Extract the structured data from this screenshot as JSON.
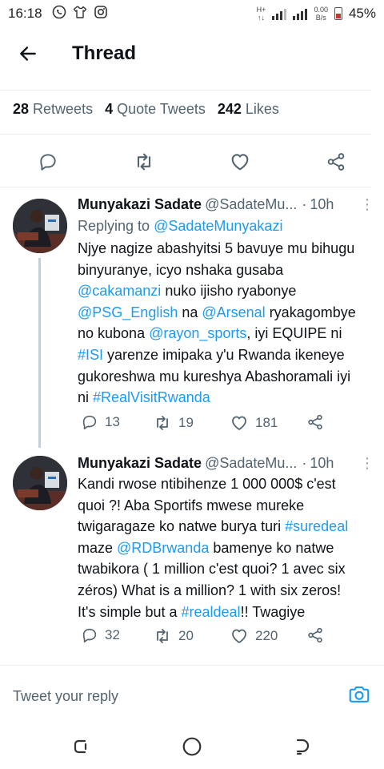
{
  "status_bar": {
    "time": "16:18",
    "network_type": "H+",
    "data_speed": "0.00",
    "data_speed_unit": "B/s",
    "battery": "45%",
    "battery_level": 0.45,
    "icons": [
      "whatsapp-icon",
      "shirt-icon",
      "instagram-icon"
    ]
  },
  "header": {
    "title": "Thread"
  },
  "stats": {
    "retweets_count": "28",
    "retweets_label": "Retweets",
    "quotes_count": "4",
    "quotes_label": "Quote Tweets",
    "likes_count": "242",
    "likes_label": "Likes"
  },
  "tweets": [
    {
      "name": "Munyakazi Sadate",
      "handle": "@SadateMu...",
      "dot": "·",
      "time": "10h",
      "reply_prefix": "Replying to",
      "reply_to": "@SadateMunyakazi",
      "body_lines": [
        [
          {
            "t": "Njye nagize abashyitsi 5 bavuye mu bihugu"
          }
        ],
        [
          {
            "t": "binyuranye, icyo nshaka gusaba"
          }
        ],
        [
          {
            "t": "@cakamanzi",
            "link": true
          },
          {
            "t": " nuko ijisho ryabonye"
          }
        ],
        [
          {
            "t": "@PSG_English",
            "link": true
          },
          {
            "t": " na "
          },
          {
            "t": "@Arsenal",
            "link": true
          },
          {
            "t": " ryakagombye"
          }
        ],
        [
          {
            "t": "no kubona "
          },
          {
            "t": "@rayon_sports",
            "link": true
          },
          {
            "t": ", iyi EQUIPE ni"
          }
        ],
        [
          {
            "t": "#ISI",
            "link": true
          },
          {
            "t": " yarenze imipaka y'u Rwanda ikeneye"
          }
        ],
        [
          {
            "t": "gukoreshwa mu kureshya Abashoramali iyi"
          }
        ],
        [
          {
            "t": "ni "
          },
          {
            "t": "#RealVisitRwanda",
            "link": true
          }
        ]
      ],
      "replies": "13",
      "retweets": "19",
      "likes": "181"
    },
    {
      "name": "Munyakazi Sadate",
      "handle": "@SadateMu...",
      "dot": "·",
      "time": "10h",
      "body_lines": [
        [
          {
            "t": "Kandi rwose ntibihenze 1 000 000$ c'est"
          }
        ],
        [
          {
            "t": "quoi ?! Aba Sportifs mwese mureke"
          }
        ],
        [
          {
            "t": "twigaragaze ko natwe burya turi "
          },
          {
            "t": "#suredeal",
            "link": true
          }
        ],
        [
          {
            "t": "maze "
          },
          {
            "t": "@RDBrwanda",
            "link": true
          },
          {
            "t": " bamenye ko natwe"
          }
        ],
        [
          {
            "t": "twabikora ( 1 million c'est quoi? 1 avec six"
          }
        ],
        [
          {
            "t": "zéros) What is a million? 1 with six zeros!"
          }
        ],
        [
          {
            "t": "It's simple but a "
          },
          {
            "t": "#realdeal",
            "link": true
          },
          {
            "t": "!! Twagiye"
          }
        ]
      ],
      "replies": "32",
      "retweets": "20",
      "likes": "220"
    }
  ],
  "reply_box": {
    "placeholder": "Tweet your reply"
  },
  "colors": {
    "link": "#1d9bf0",
    "secondary_text": "#536471",
    "divider": "#e6ecf0"
  }
}
